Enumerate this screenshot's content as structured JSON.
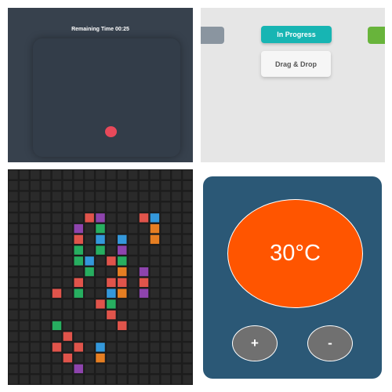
{
  "game": {
    "timer_text": "Remaining Time 00:25",
    "ball_color": "#e8495a",
    "background": "#37414d"
  },
  "drag_drop": {
    "status_label": "In Progress",
    "status_color": "#17b5b3",
    "card_label": "Drag & Drop",
    "left_chip_color": "#8a95a0",
    "right_chip_color": "#68b43b"
  },
  "tile_grid": {
    "columns": 17,
    "rows": 20,
    "empty_color": "#2a2a2a",
    "colored_tiles": [
      {
        "row": 4,
        "col": 7,
        "color": "#e0544b"
      },
      {
        "row": 4,
        "col": 8,
        "color": "#8e44ad"
      },
      {
        "row": 4,
        "col": 12,
        "color": "#e0544b"
      },
      {
        "row": 4,
        "col": 13,
        "color": "#3498db"
      },
      {
        "row": 5,
        "col": 6,
        "color": "#8e44ad"
      },
      {
        "row": 5,
        "col": 8,
        "color": "#27ae60"
      },
      {
        "row": 5,
        "col": 13,
        "color": "#e67e22"
      },
      {
        "row": 6,
        "col": 6,
        "color": "#e0544b"
      },
      {
        "row": 6,
        "col": 8,
        "color": "#3498db"
      },
      {
        "row": 6,
        "col": 10,
        "color": "#3498db"
      },
      {
        "row": 6,
        "col": 13,
        "color": "#e67e22"
      },
      {
        "row": 7,
        "col": 6,
        "color": "#27ae60"
      },
      {
        "row": 7,
        "col": 8,
        "color": "#27ae60"
      },
      {
        "row": 7,
        "col": 10,
        "color": "#8e44ad"
      },
      {
        "row": 8,
        "col": 6,
        "color": "#27ae60"
      },
      {
        "row": 8,
        "col": 7,
        "color": "#3498db"
      },
      {
        "row": 8,
        "col": 9,
        "color": "#e0544b"
      },
      {
        "row": 8,
        "col": 10,
        "color": "#27ae60"
      },
      {
        "row": 9,
        "col": 7,
        "color": "#27ae60"
      },
      {
        "row": 9,
        "col": 10,
        "color": "#e67e22"
      },
      {
        "row": 9,
        "col": 12,
        "color": "#8e44ad"
      },
      {
        "row": 10,
        "col": 6,
        "color": "#e0544b"
      },
      {
        "row": 10,
        "col": 9,
        "color": "#e0544b"
      },
      {
        "row": 10,
        "col": 10,
        "color": "#e0544b"
      },
      {
        "row": 10,
        "col": 12,
        "color": "#e0544b"
      },
      {
        "row": 11,
        "col": 4,
        "color": "#e0544b"
      },
      {
        "row": 11,
        "col": 6,
        "color": "#27ae60"
      },
      {
        "row": 11,
        "col": 9,
        "color": "#3498db"
      },
      {
        "row": 11,
        "col": 10,
        "color": "#e67e22"
      },
      {
        "row": 11,
        "col": 12,
        "color": "#8e44ad"
      },
      {
        "row": 12,
        "col": 8,
        "color": "#e0544b"
      },
      {
        "row": 12,
        "col": 9,
        "color": "#27ae60"
      },
      {
        "row": 13,
        "col": 9,
        "color": "#e0544b"
      },
      {
        "row": 14,
        "col": 4,
        "color": "#27ae60"
      },
      {
        "row": 14,
        "col": 10,
        "color": "#e0544b"
      },
      {
        "row": 15,
        "col": 5,
        "color": "#e0544b"
      },
      {
        "row": 16,
        "col": 4,
        "color": "#e0544b"
      },
      {
        "row": 16,
        "col": 6,
        "color": "#e0544b"
      },
      {
        "row": 16,
        "col": 8,
        "color": "#3498db"
      },
      {
        "row": 17,
        "col": 5,
        "color": "#e0544b"
      },
      {
        "row": 17,
        "col": 8,
        "color": "#e67e22"
      },
      {
        "row": 18,
        "col": 6,
        "color": "#8e44ad"
      }
    ]
  },
  "thermostat": {
    "temperature_display": "30°C",
    "display_color": "#ff5500",
    "card_color": "#2b5876",
    "increase_label": "+",
    "decrease_label": "-"
  }
}
